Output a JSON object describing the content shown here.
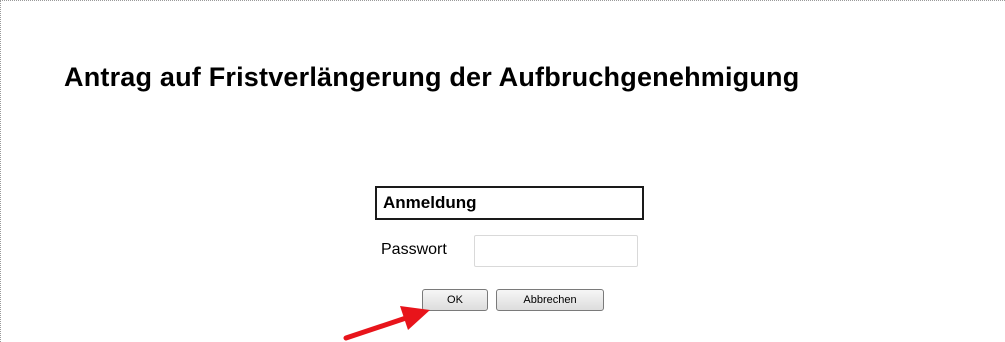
{
  "page": {
    "title": "Antrag auf Fristverlängerung der Aufbruchgenehmigung"
  },
  "login": {
    "header": "Anmeldung",
    "password_label": "Passwort",
    "password_value": "",
    "ok_label": "OK",
    "cancel_label": "Abbrechen"
  },
  "annotation": {
    "arrow_color": "#e8141b",
    "arrow_icon": "red-arrow-icon"
  }
}
